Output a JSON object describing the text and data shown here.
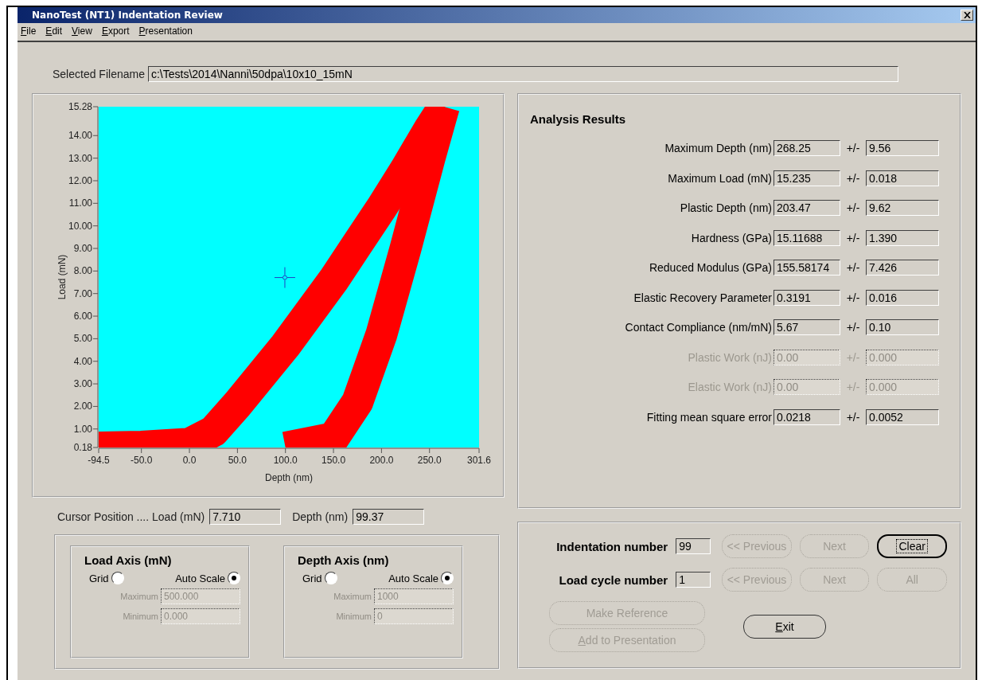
{
  "window": {
    "title": "NanoTest (NT1) Indentation Review"
  },
  "menu": [
    {
      "label": "File"
    },
    {
      "label": "Edit"
    },
    {
      "label": "View"
    },
    {
      "label": "Export"
    },
    {
      "label": "Presentation"
    }
  ],
  "filename": {
    "label": "Selected Filename",
    "value": "c:\\Tests\\2014\\Nanni\\50dpa\\10x10_15mN"
  },
  "plot": {
    "chart_data": {
      "type": "line",
      "xlabel": "Depth (nm)",
      "ylabel": "Load (mN)",
      "xlim": [
        -94.5,
        301.6
      ],
      "ylim": [
        0.18,
        15.28
      ],
      "xticks": [
        {
          "value": -94.5,
          "label": "-94.5"
        },
        {
          "value": -50,
          "label": "-50.0"
        },
        {
          "value": 0,
          "label": "0.0"
        },
        {
          "value": 50,
          "label": "50.0"
        },
        {
          "value": 100,
          "label": "100.0"
        },
        {
          "value": 150,
          "label": "150.0"
        },
        {
          "value": 200,
          "label": "200.0"
        },
        {
          "value": 250,
          "label": "250.0"
        },
        {
          "value": 301.6,
          "label": "301.6"
        }
      ],
      "yticks": [
        {
          "value": 0.18,
          "label": "0.18"
        },
        {
          "value": 1,
          "label": "1.00"
        },
        {
          "value": 2,
          "label": "2.00"
        },
        {
          "value": 3,
          "label": "3.00"
        },
        {
          "value": 4,
          "label": "4.00"
        },
        {
          "value": 5,
          "label": "5.00"
        },
        {
          "value": 6,
          "label": "6.00"
        },
        {
          "value": 7,
          "label": "7.00"
        },
        {
          "value": 8,
          "label": "8.00"
        },
        {
          "value": 9,
          "label": "9.00"
        },
        {
          "value": 10,
          "label": "10.00"
        },
        {
          "value": 11,
          "label": "11.00"
        },
        {
          "value": 12,
          "label": "12.00"
        },
        {
          "value": 13,
          "label": "13.00"
        },
        {
          "value": 14,
          "label": "14.00"
        },
        {
          "value": 15.28,
          "label": "15.28"
        }
      ],
      "x": [
        -94.5,
        -50,
        0,
        25,
        50,
        100,
        150,
        175,
        200,
        225,
        250,
        265
      ],
      "series": [
        {
          "color": "#ff0000",
          "values": [
            0.18,
            0.22,
            0.35,
            0.9,
            2.1,
            4.7,
            7.6,
            9.2,
            10.8,
            12.5,
            14.3,
            15.28
          ]
        },
        {
          "color": "#ff0000",
          "values": [
            null,
            null,
            null,
            null,
            null,
            0.18,
            0.6,
            2.2,
            5.2,
            9.0,
            13.0,
            15.28
          ]
        }
      ]
    }
  },
  "cursor": {
    "label": "Cursor Position .... Load (mN)",
    "load": "7.710",
    "depth_label": "Depth (nm)",
    "depth": "99.37"
  },
  "axes": [
    {
      "title": "Load Axis (mN)",
      "options": [
        {
          "label": "Grid",
          "selected": false
        },
        {
          "label": "Auto Scale",
          "selected": true
        }
      ],
      "fields": [
        {
          "label": "Maximum",
          "value": "500.000",
          "disabled": true
        },
        {
          "label": "Minimum",
          "value": "0.000",
          "disabled": true
        }
      ]
    },
    {
      "title": "Depth Axis (nm)",
      "options": [
        {
          "label": "Grid",
          "selected": false
        },
        {
          "label": "Auto Scale",
          "selected": true
        }
      ],
      "fields": [
        {
          "label": "Maximum",
          "value": "1000",
          "disabled": true
        },
        {
          "label": "Minimum",
          "value": "0",
          "disabled": true
        }
      ]
    }
  ],
  "results": {
    "title": "Analysis Results",
    "rows": [
      {
        "label": "Maximum Depth (nm)",
        "value": "268.25",
        "pm": "+/-",
        "error": "9.56",
        "disabled": false
      },
      {
        "label": "Maximum Load (mN)",
        "value": "15.235",
        "pm": "+/-",
        "error": "0.018",
        "disabled": false
      },
      {
        "label": "Plastic Depth (nm)",
        "value": "203.47",
        "pm": "+/-",
        "error": "9.62",
        "disabled": false
      },
      {
        "label": "Hardness (GPa)",
        "value": "15.11688",
        "pm": "+/-",
        "error": "1.390",
        "disabled": false
      },
      {
        "label": "Reduced Modulus (GPa)",
        "value": "155.58174",
        "pm": "+/-",
        "error": "7.426",
        "disabled": false
      },
      {
        "label": "Elastic Recovery Parameter",
        "value": "0.3191",
        "pm": "+/-",
        "error": "0.016",
        "disabled": false
      },
      {
        "label": "Contact Compliance (nm/mN)",
        "value": "5.67",
        "pm": "+/-",
        "error": "0.10",
        "disabled": false
      },
      {
        "label": "Plastic Work (nJ)",
        "value": "0.00",
        "pm": "+/-",
        "error": "0.000",
        "disabled": true
      },
      {
        "label": "Elastic Work (nJ)",
        "value": "0.00",
        "pm": "+/-",
        "error": "0.000",
        "disabled": true
      },
      {
        "label": "Fitting mean square error",
        "value": "0.0218",
        "pm": "+/-",
        "error": "0.0052",
        "disabled": false
      }
    ]
  },
  "navigation": [
    {
      "label": "Indentation number",
      "value": "99",
      "buttons": [
        {
          "label": "<< Previous",
          "disabled": true,
          "focused": false
        },
        {
          "label": "Next",
          "disabled": true,
          "focused": false
        },
        {
          "label": "Clear",
          "disabled": false,
          "focused": true
        }
      ]
    },
    {
      "label": "Load cycle number",
      "value": "1",
      "buttons": [
        {
          "label": "<< Previous",
          "disabled": true,
          "focused": false
        },
        {
          "label": "Next",
          "disabled": true,
          "focused": false
        },
        {
          "label": "All",
          "disabled": true,
          "focused": false
        }
      ]
    }
  ],
  "actions": [
    {
      "label": "Make Reference",
      "disabled": true
    },
    {
      "label": "Add to Presentation",
      "disabled": true
    }
  ],
  "exit": {
    "label": "Exit",
    "disabled": false
  }
}
